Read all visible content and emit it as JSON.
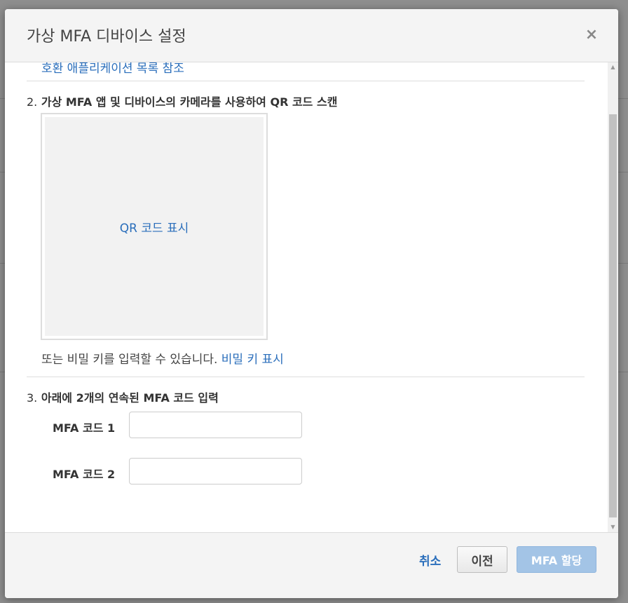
{
  "modal": {
    "title": "가상 MFA 디바이스 설정",
    "close_symbol": "×"
  },
  "body": {
    "cut_link_text": "호환 애플리케이션 목록 참조",
    "step2": {
      "number": "2.",
      "title": "가상 MFA 앱 및 디바이스의 카메라를 사용하여 QR 코드 스캔",
      "qr_link": "QR 코드 표시",
      "secret_prefix": "또는 비밀 키를 입력할 수 있습니다. ",
      "secret_link": "비밀 키 표시"
    },
    "step3": {
      "number": "3.",
      "title": "아래에 2개의 연속된 MFA 코드 입력",
      "field1_label": "MFA 코드 1",
      "field1_value": "",
      "field2_label": "MFA 코드 2",
      "field2_value": ""
    }
  },
  "footer": {
    "cancel_label": "취소",
    "prev_label": "이전",
    "assign_label": "MFA 할당"
  },
  "colors": {
    "link": "#2a6ebb",
    "primary_disabled": "#a3c4e6"
  }
}
